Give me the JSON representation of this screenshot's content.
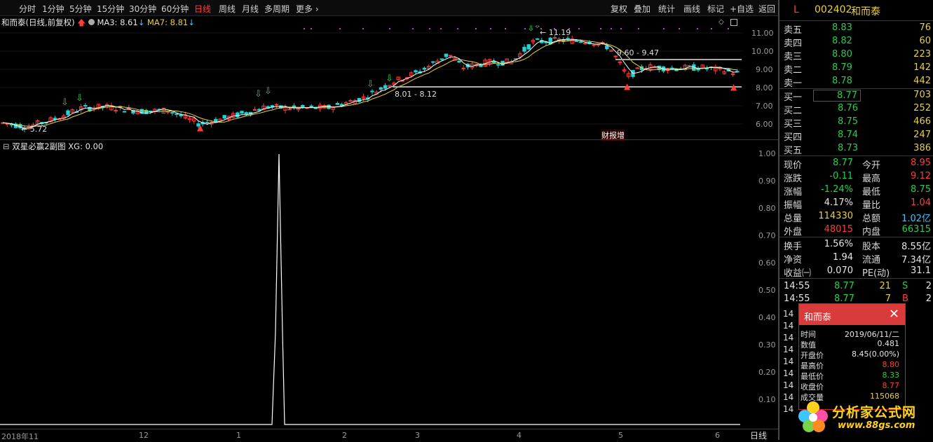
{
  "toolbar": {
    "periods": [
      "分时",
      "1分钟",
      "5分钟",
      "15分钟",
      "30分钟",
      "60分钟",
      "日线",
      "周线",
      "月线",
      "多周期",
      "更多"
    ],
    "active_period": "日线",
    "tools": [
      "复权",
      "叠加",
      "统计",
      "画线",
      "标记",
      "+自选",
      "返回"
    ]
  },
  "main_chart": {
    "stock_title": "和而泰",
    "mode": "(日线,前复权)",
    "ma3_label": "MA3: 8.61",
    "ma7_label": "MA7: 8.81",
    "y_ticks": [
      "11.00",
      "10.00",
      "9.00",
      "8.00",
      "7.00",
      "6.00"
    ],
    "annotations": {
      "high": "11.19",
      "low": "5.72",
      "range1": "9.60 - 9.47",
      "range2": "8.01 - 8.12",
      "event": "财报增"
    }
  },
  "sub_chart": {
    "title": "双星必赢2副图",
    "xg_label": "XG: 0.00",
    "y_ticks": [
      "1.00",
      "0.90",
      "0.80",
      "0.70",
      "0.60",
      "0.50",
      "0.40",
      "0.30",
      "0.20",
      "0.10"
    ]
  },
  "x_axis": {
    "labels": [
      "2018年11",
      "12",
      "1",
      "2",
      "3",
      "4",
      "5",
      "6"
    ],
    "period_tag": "日线"
  },
  "quote": {
    "marker": "L",
    "code": "002402",
    "name": "和而泰",
    "asks": [
      {
        "label": "卖五",
        "price": "8.83",
        "vol": "76"
      },
      {
        "label": "卖四",
        "price": "8.82",
        "vol": "60"
      },
      {
        "label": "卖三",
        "price": "8.80",
        "vol": "223"
      },
      {
        "label": "卖二",
        "price": "8.79",
        "vol": "142"
      },
      {
        "label": "卖一",
        "price": "8.78",
        "vol": "442"
      }
    ],
    "bids": [
      {
        "label": "买一",
        "price": "8.77",
        "vol": "703"
      },
      {
        "label": "买二",
        "price": "8.76",
        "vol": "252"
      },
      {
        "label": "买三",
        "price": "8.75",
        "vol": "466"
      },
      {
        "label": "买四",
        "price": "8.74",
        "vol": "247"
      },
      {
        "label": "买五",
        "price": "8.73",
        "vol": "386"
      }
    ],
    "stats": [
      {
        "k1": "现价",
        "v1": "8.77",
        "c1": "green",
        "k2": "今开",
        "v2": "8.95",
        "c2": "red"
      },
      {
        "k1": "涨跌",
        "v1": "-0.11",
        "c1": "green",
        "k2": "最高",
        "v2": "9.12",
        "c2": "red"
      },
      {
        "k1": "涨幅",
        "v1": "-1.24%",
        "c1": "green",
        "k2": "最低",
        "v2": "8.75",
        "c2": "green"
      },
      {
        "k1": "振幅",
        "v1": "4.17%",
        "c1": "white",
        "k2": "量比",
        "v2": "1.04",
        "c2": "red"
      },
      {
        "k1": "总量",
        "v1": "114330",
        "c1": "yellow",
        "k2": "总额",
        "v2": "1.02亿",
        "c2": "cyan"
      },
      {
        "k1": "外盘",
        "v1": "48015",
        "c1": "red",
        "k2": "内盘",
        "v2": "66315",
        "c2": "green"
      }
    ],
    "stats2": [
      {
        "k1": "换手",
        "v1": "1.56%",
        "k2": "股本",
        "v2": "8.55亿"
      },
      {
        "k1": "净资",
        "v1": "1.94",
        "k2": "流通",
        "v2": "7.34亿"
      },
      {
        "k1": "收益㈠",
        "v1": "0.070",
        "k2": "PE(动)",
        "v2": "31.1"
      }
    ],
    "ticks": [
      {
        "time": "14:55",
        "price": "8.77",
        "vol": "21",
        "flag": "S",
        "n": "2"
      },
      {
        "time": "14:55",
        "price": "8.77",
        "vol": "7",
        "flag": "B",
        "n": "2"
      }
    ]
  },
  "popup": {
    "title": "和而泰",
    "rows": [
      {
        "k": "时间",
        "v": "2019/06/11/二",
        "c": "white"
      },
      {
        "k": "数值",
        "v": "0.481",
        "c": "white"
      },
      {
        "k": "开盘价",
        "v": "8.45(0.00%)",
        "c": "white"
      },
      {
        "k": "最高价",
        "v": "8.80",
        "c": "red"
      },
      {
        "k": "最低价",
        "v": "8.33",
        "c": "green"
      },
      {
        "k": "收盘价",
        "v": "8.77",
        "c": "red"
      },
      {
        "k": "成交量",
        "v": "115068",
        "c": "yellow"
      }
    ]
  },
  "watermark": {
    "text": "分析家公式网",
    "url": "www.88gs.com"
  },
  "colors": {
    "up": "#ff3b3b",
    "down": "#22d1d1",
    "ma3": "#ffffff",
    "ma7": "#e8d040",
    "green_arrow": "#22d14a"
  }
}
